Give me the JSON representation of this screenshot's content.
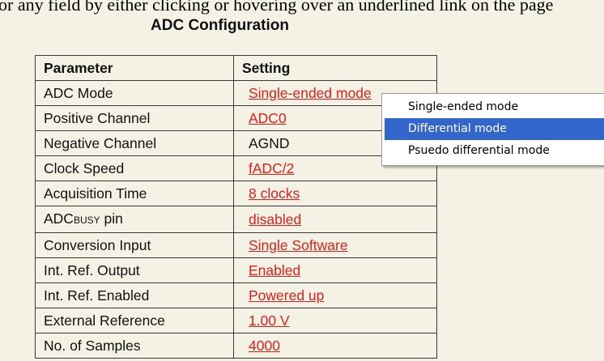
{
  "intro_text": "or any field by either clicking or hovering over an underlined link on the page",
  "section_title": "ADC Configuration",
  "table": {
    "headers": [
      "Parameter",
      "Setting"
    ],
    "rows": [
      {
        "param": "ADC Mode",
        "setting": "Single-ended mode",
        "link": true
      },
      {
        "param": "Positive Channel",
        "setting": "ADC0",
        "link": true
      },
      {
        "param": "Negative Channel",
        "setting": "AGND",
        "link": false
      },
      {
        "param": "Clock Speed",
        "setting": "fADC/2",
        "link": true
      },
      {
        "param": "Acquisition Time",
        "setting": "8 clocks",
        "link": true
      },
      {
        "param": "ADC",
        "param_sub": "BUSY",
        "param_suffix": " pin",
        "setting": "disabled",
        "link": true
      },
      {
        "param": "Conversion Input",
        "setting": "Single Software",
        "link": true
      },
      {
        "param": "Int. Ref. Output",
        "setting": "Enabled",
        "link": true
      },
      {
        "param": "Int. Ref. Enabled",
        "setting": "Powered up",
        "link": true
      },
      {
        "param": "External Reference",
        "setting": "1.00 V",
        "link": true
      },
      {
        "param": "No. of Samples",
        "setting": "4000",
        "link": true
      }
    ]
  },
  "dropdown": {
    "options": [
      "Single-ended mode",
      "Differential mode",
      "Psuedo differential mode"
    ],
    "highlighted_index": 1
  },
  "colors": {
    "background": "#f4f2e4",
    "link": "#e1201c",
    "highlight": "#3366cc",
    "border": "#3a3a3a"
  }
}
